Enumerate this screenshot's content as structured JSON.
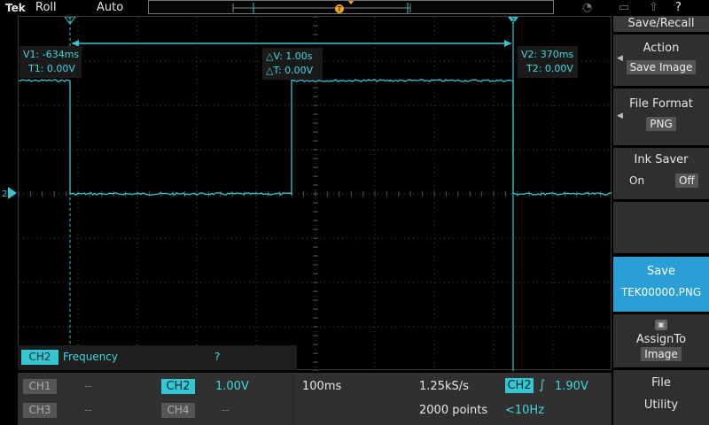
{
  "top": {
    "logo": "Tek",
    "mode": "Roll",
    "trigger_mode": "Auto",
    "trigger_marker": "T",
    "icons": [
      "wifi-icon",
      "network-icon",
      "export-icon",
      "help-icon"
    ],
    "help_glyph": "?"
  },
  "cursors": {
    "c1": {
      "v": "V1: -634ms",
      "t": "T1: 0.00V",
      "marker": "1"
    },
    "delta": {
      "v": "△V: 1.00s",
      "t": "△T: 0.00V"
    },
    "c2": {
      "v": "V2: 370ms",
      "t": "T2: 0.00V",
      "marker": "2"
    },
    "channel_marker": "2"
  },
  "measurement": {
    "channel": "CH2",
    "label": "Frequency",
    "value": "?"
  },
  "channels": {
    "ch1": {
      "label": "CH1",
      "value": "--"
    },
    "ch2": {
      "label": "CH2",
      "value": "1.00V"
    },
    "ch3": {
      "label": "CH3",
      "value": "--"
    },
    "ch4": {
      "label": "CH4",
      "value": "--"
    }
  },
  "acquisition": {
    "timebase": "100ms",
    "sample_rate": "1.25kS/s",
    "record_length": "2000 points",
    "trigger_channel": "CH2",
    "trigger_slope": "∫",
    "trigger_level": "1.90V",
    "trigger_freq": "<10Hz"
  },
  "menu": {
    "header": "Save/Recall",
    "action_title": "Action",
    "action_value": "Save Image",
    "format_title": "File Format",
    "format_value": "PNG",
    "ink_title": "Ink Saver",
    "ink_on": "On",
    "ink_off": "Off",
    "save_title": "Save",
    "save_filename": "TEK00000.PNG",
    "assign_title": "AssignTo",
    "assign_value": "Image",
    "file_title": "File",
    "utility_title": "Utility",
    "arrow": "◀"
  },
  "colors": {
    "waveform": "#35c6d3",
    "save_highlight": "#2a9fd6",
    "background": "#000000"
  }
}
